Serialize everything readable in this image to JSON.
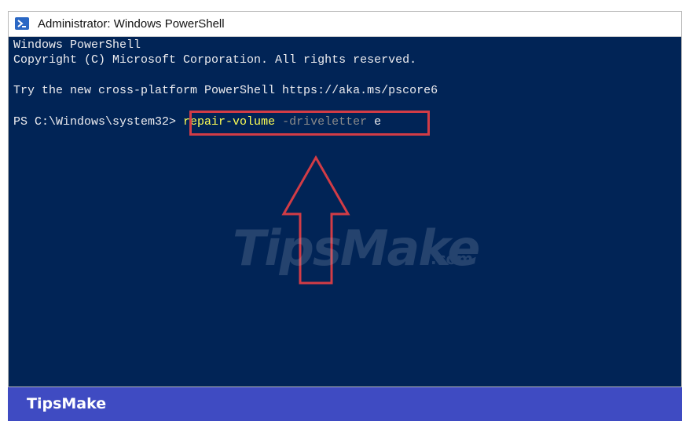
{
  "window": {
    "title": "Administrator: Windows PowerShell",
    "icon": "powershell-icon"
  },
  "console": {
    "lines": [
      "Windows PowerShell",
      "Copyright (C) Microsoft Corporation. All rights reserved.",
      "Try the new cross-platform PowerShell https://aka.ms/pscore6"
    ],
    "prompt": "PS C:\\Windows\\system32> ",
    "command": {
      "cmdlet": "repair-volume",
      "parameter": "-driveletter",
      "argument": "e"
    }
  },
  "annotation": {
    "highlight_color": "#d23c46",
    "arrow": "up-arrow-icon"
  },
  "watermark": {
    "text": "TipsMake",
    "suffix": ".com"
  },
  "footer": {
    "brand": "TipsMake",
    "color": "#3f4bc2"
  },
  "colors": {
    "console_bg": "#012456",
    "cmdlet": "#ffff54",
    "parameter": "#8a8a8a"
  }
}
